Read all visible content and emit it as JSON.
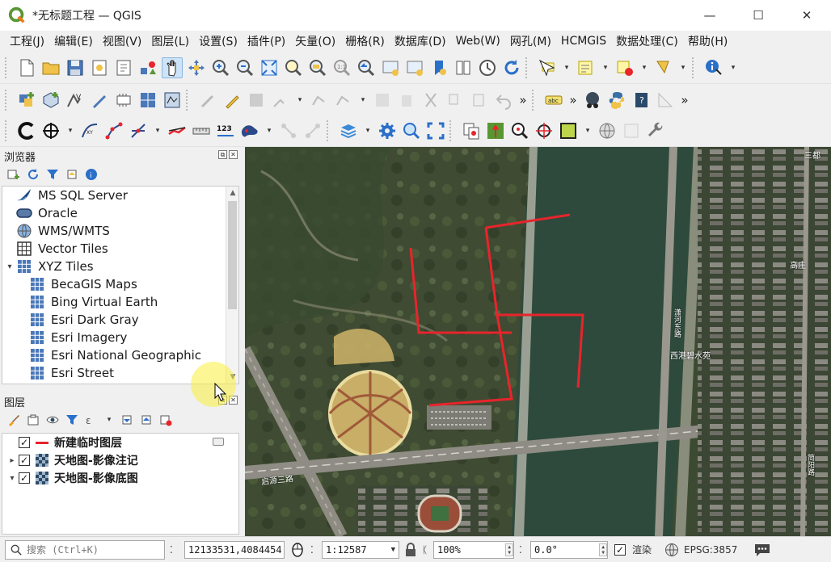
{
  "window": {
    "title": "*无标题工程 — QGIS",
    "minimize_glyph": "—",
    "maximize_glyph": "☐",
    "close_glyph": "✕"
  },
  "menu": [
    "工程(J)",
    "编辑(E)",
    "视图(V)",
    "图层(L)",
    "设置(S)",
    "插件(P)",
    "矢量(O)",
    "栅格(R)",
    "数据库(D)",
    "Web(W)",
    "网孔(M)",
    "HCMGIS",
    "数据处理(C)",
    "帮助(H)"
  ],
  "toolbar_more": "»",
  "browser": {
    "title": "浏览器",
    "items": [
      {
        "label": "MS SQL Server",
        "icon": "mssql-icon",
        "indent": 0
      },
      {
        "label": "Oracle",
        "icon": "oracle-icon",
        "indent": 0
      },
      {
        "label": "WMS/WMTS",
        "icon": "wms-icon",
        "indent": 0
      },
      {
        "label": "Vector Tiles",
        "icon": "vector-tiles-icon",
        "indent": 0
      },
      {
        "label": "XYZ Tiles",
        "icon": "xyz-tiles-icon",
        "indent": 0,
        "expanded": true
      },
      {
        "label": "BecaGIS Maps",
        "icon": "xyz-tiles-icon",
        "indent": 1
      },
      {
        "label": "Bing Virtual Earth",
        "icon": "xyz-tiles-icon",
        "indent": 1
      },
      {
        "label": "Esri Dark Gray",
        "icon": "xyz-tiles-icon",
        "indent": 1
      },
      {
        "label": "Esri Imagery",
        "icon": "xyz-tiles-icon",
        "indent": 1
      },
      {
        "label": "Esri National Geographic",
        "icon": "xyz-tiles-icon",
        "indent": 1
      },
      {
        "label": "Esri Street",
        "icon": "xyz-tiles-icon",
        "indent": 1
      }
    ]
  },
  "layers": {
    "title": "图层",
    "items": [
      {
        "label": "新建临时图层",
        "checked": true,
        "symbol": "line",
        "expand": "",
        "editing": true
      },
      {
        "label": "天地图-影像注记",
        "checked": true,
        "symbol": "raster",
        "expand": "▸",
        "editing": false
      },
      {
        "label": "天地图-影像底图",
        "checked": true,
        "symbol": "raster",
        "expand": "▾",
        "editing": false
      }
    ]
  },
  "map": {
    "labels": [
      "三都",
      "高庄",
      "潇河东路",
      "西港碧水苑",
      "启源三路",
      "简阳路"
    ],
    "line_color": "#e8242c"
  },
  "status": {
    "search_placeholder": "搜索 (Ctrl+K)",
    "coordinate": "12133531,4084454",
    "scale": "1:12587",
    "magnifier": "100%",
    "rotation": "0.0°",
    "render_label": "渲染",
    "render_checked": true,
    "crs": "EPSG:3857",
    "checkmark": "✓"
  },
  "colors": {
    "accent": "#589632",
    "red_line": "#e8242c",
    "water": "#2f4a3c"
  }
}
